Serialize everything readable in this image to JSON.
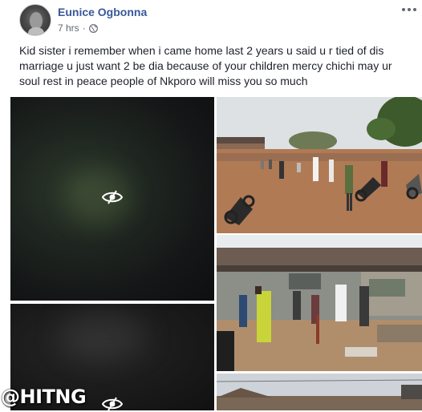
{
  "post": {
    "author_name": "Eunice Ogbonna",
    "timestamp": "7 hrs",
    "separator": "·",
    "privacy_icon": "globe-icon",
    "more_icon": "more-options-icon",
    "text": "Kid sister i remember when i came home last 2 years u said u r tied of dis marriage u just want 2 be dia because of your children mercy chichi may ur soul rest in peace people of Nkporo will miss you so much"
  },
  "photos": [
    {
      "kind": "sensitive-blurred",
      "overlay_icon": "hidden-eye-icon"
    },
    {
      "kind": "crowd-street-scene"
    },
    {
      "kind": "sensitive-blurred",
      "overlay_icon": "hidden-eye-icon"
    },
    {
      "kind": "crowd-building-scene"
    },
    {
      "kind": "roof-scene"
    }
  ],
  "watermark": "@HITNG",
  "colors": {
    "link": "#385898",
    "meta": "#606770",
    "text": "#1d2129"
  }
}
